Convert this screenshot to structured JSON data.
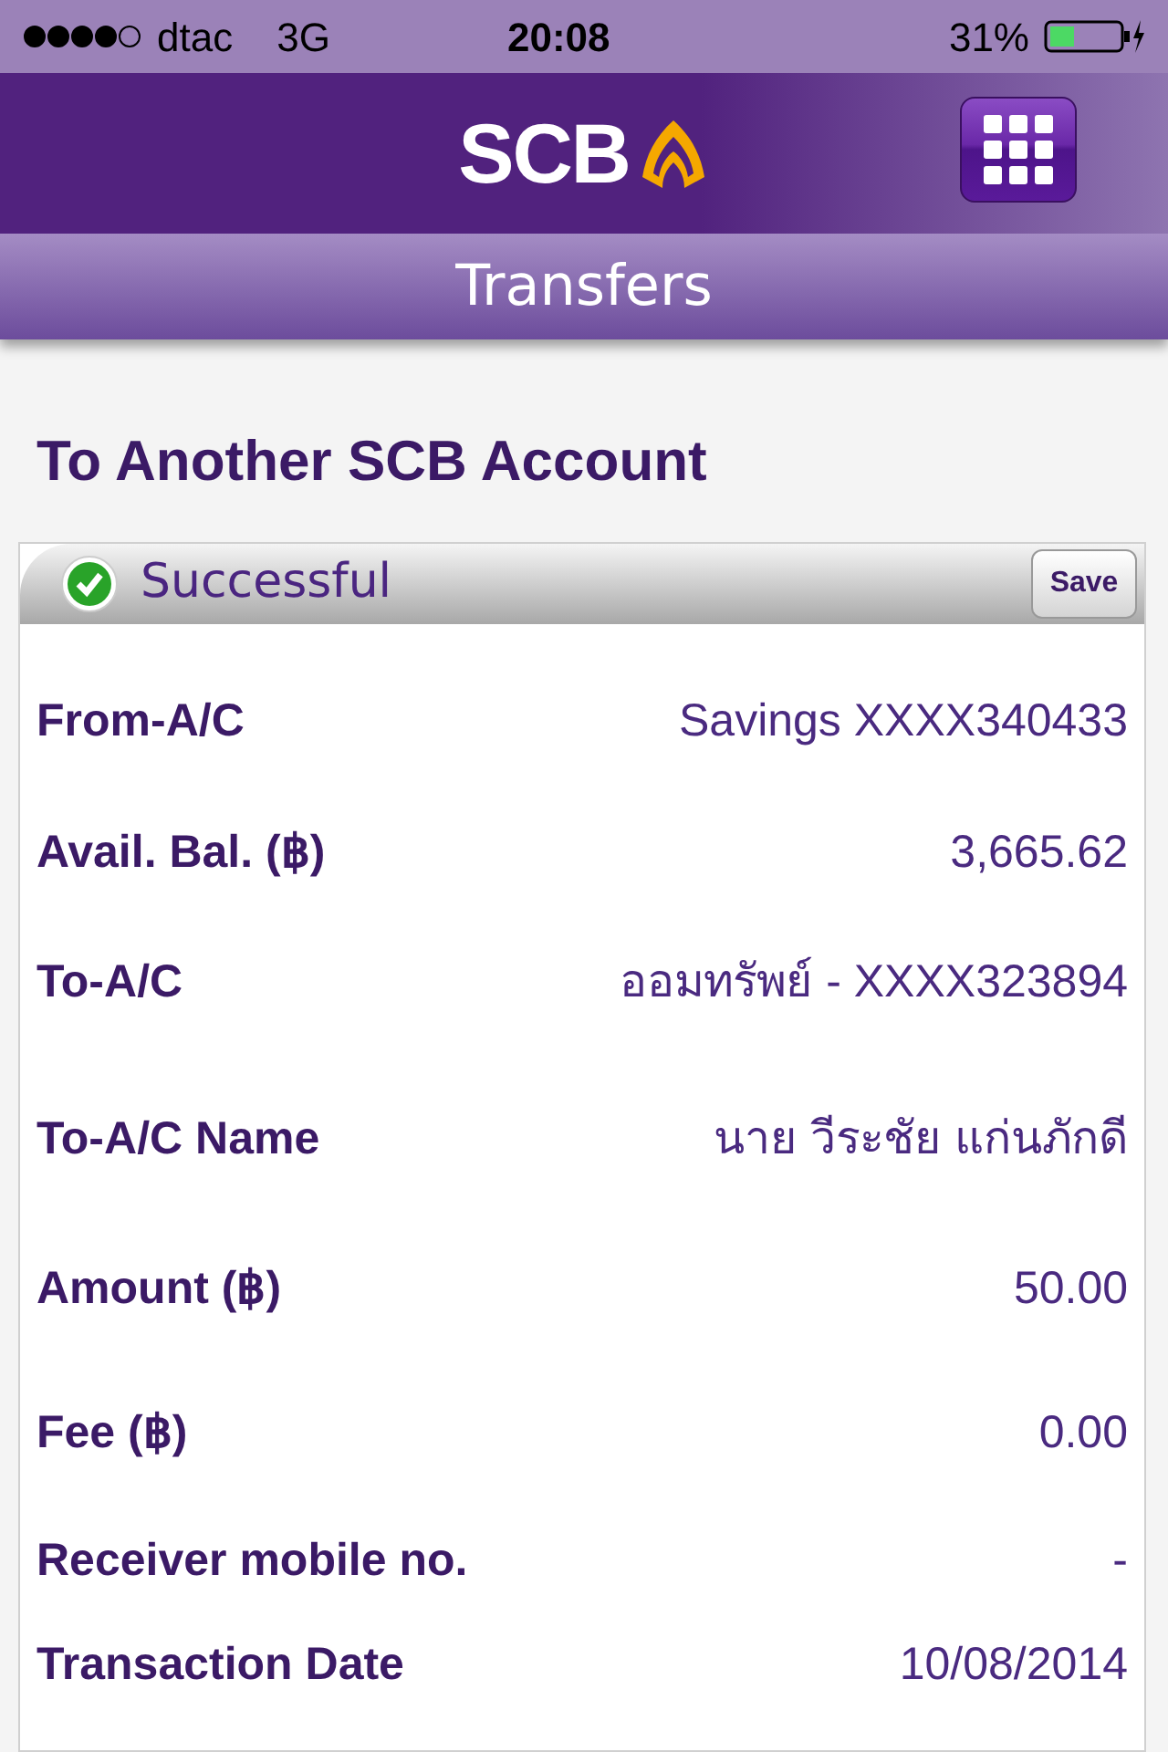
{
  "status_bar": {
    "carrier": "dtac",
    "network": "3G",
    "time": "20:08",
    "battery": "31%"
  },
  "header": {
    "logo": "SCB"
  },
  "title_bar": {
    "title": "Transfers"
  },
  "page_title": "To Another SCB Account",
  "result": {
    "status": "Successful",
    "save_button": "Save"
  },
  "details": [
    {
      "label": "From-A/C",
      "value": "Savings XXXX340433"
    },
    {
      "label": "Avail. Bal. (฿)",
      "value": "3,665.62"
    },
    {
      "label": "To-A/C",
      "value": "ออมทรัพย์ - XXXX323894"
    },
    {
      "label": "To-A/C Name",
      "value": "นาย วีระชัย แก่นภักดี"
    },
    {
      "label": "Amount (฿)",
      "value": "50.00"
    },
    {
      "label": "Fee (฿)",
      "value": "0.00"
    },
    {
      "label": "Receiver mobile no.",
      "value": "-"
    },
    {
      "label": "Transaction Date",
      "value": "10/08/2014"
    }
  ]
}
